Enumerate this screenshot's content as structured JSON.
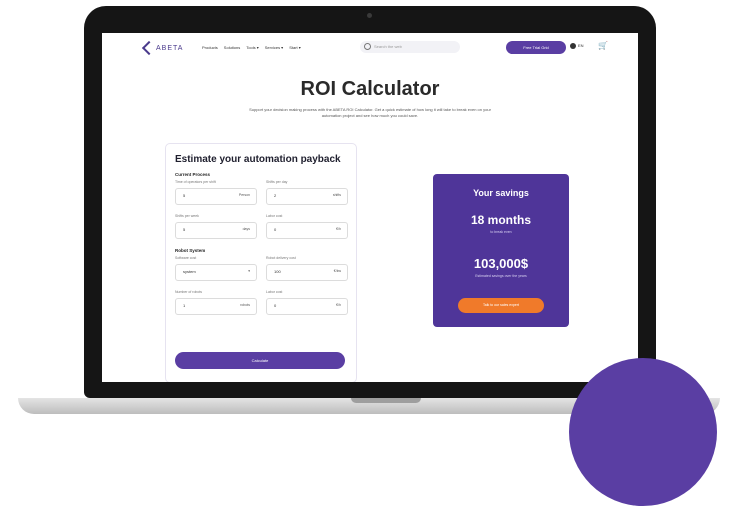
{
  "brand": {
    "logo_text": "ABETA",
    "accent": "#5a3ea3",
    "orange": "#f07a2a"
  },
  "nav": {
    "items": [
      "Products",
      "Solutions",
      "Tools ▾",
      "Services ▾",
      "Start ▾"
    ],
    "search_placeholder": "Search the web",
    "cta_label": "Free Trial Grid",
    "lang_label": "EN",
    "cart_icon": "cart-icon"
  },
  "hero": {
    "title": "ROI Calculator",
    "subtitle": "Support your decision making process with the ABETA ROI Calculator. Get a quick estimate of how long it will take to break even on your automation project and see how much you could save."
  },
  "form": {
    "title": "Estimate your automation payback",
    "current_process_title": "Current Process",
    "robot_system_title": "Robot System",
    "fields": [
      {
        "label": "Time of operators per shift",
        "value": "5",
        "unit": "Person"
      },
      {
        "label": "Shifts per day",
        "value": "2",
        "unit": "shifts"
      },
      {
        "label": "Shifts per week",
        "value": "5",
        "unit": "days"
      },
      {
        "label": "Labor cost",
        "value": "0",
        "unit": "€/h"
      },
      {
        "label": "Software cost",
        "value": "system",
        "unit": "▾"
      },
      {
        "label": "Robot delivery cost",
        "value": "100",
        "unit": "€/kw"
      },
      {
        "label": "Number of robots",
        "value": "1",
        "unit": "robots"
      },
      {
        "label": "Labor cost",
        "value": "0",
        "unit": "€/h"
      }
    ],
    "calculate_label": "Calculate"
  },
  "savings": {
    "title": "Your savings",
    "months": "18 months",
    "months_caption": "to break even",
    "amount": "103,000$",
    "amount_caption": "Estimated savings over the years",
    "button_label": "Talk to our sales expert"
  }
}
